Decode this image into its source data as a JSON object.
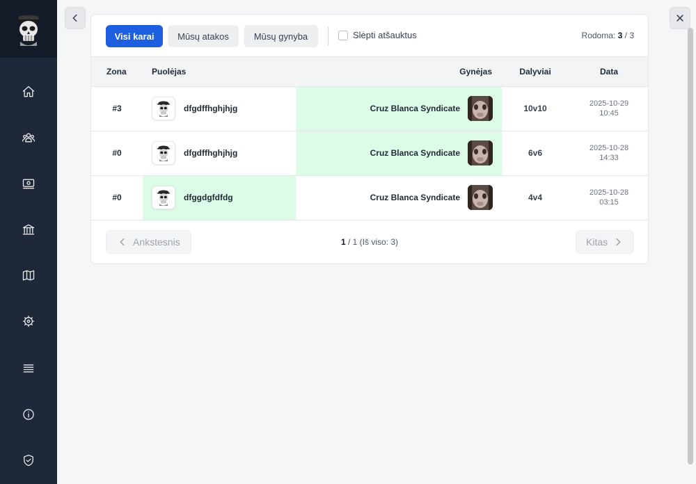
{
  "sidebar": {
    "items": [
      {
        "icon": "home-icon"
      },
      {
        "icon": "users-icon"
      },
      {
        "icon": "money-icon"
      },
      {
        "icon": "bank-icon"
      },
      {
        "icon": "map-icon"
      },
      {
        "icon": "gear-icon"
      },
      {
        "icon": "menu-icon"
      },
      {
        "icon": "info-icon"
      },
      {
        "icon": "shield-icon"
      }
    ]
  },
  "filters": {
    "tabs": [
      {
        "label": "Visi karai",
        "active": true
      },
      {
        "label": "Mūsų atakos",
        "active": false
      },
      {
        "label": "Mūsų gynyba",
        "active": false
      }
    ],
    "hide_cancelled_label": "Slėpti atšauktus",
    "showing_label": "Rodoma:",
    "showing_count": "3",
    "showing_sep": "/",
    "showing_total": "3"
  },
  "table": {
    "headers": {
      "zone": "Zona",
      "attacker": "Puolėjas",
      "defender": "Gynėjas",
      "participants": "Dalyviai",
      "date": "Data"
    },
    "rows": [
      {
        "zone": "#3",
        "attacker": "dfgdffhghjhjg",
        "defender": "Cruz Blanca Syndicate",
        "participants": "10v10",
        "date": "2025-10-29",
        "time": "10:45",
        "winner": "defender"
      },
      {
        "zone": "#0",
        "attacker": "dfgdffhghjhjg",
        "defender": "Cruz Blanca Syndicate",
        "participants": "6v6",
        "date": "2025-10-28",
        "time": "14:33",
        "winner": "defender"
      },
      {
        "zone": "#0",
        "attacker": "dfggdgfdfdg",
        "defender": "Cruz Blanca Syndicate",
        "participants": "4v4",
        "date": "2025-10-28",
        "time": "03:15",
        "winner": "attacker"
      }
    ]
  },
  "pagination": {
    "prev_label": "Ankstesnis",
    "next_label": "Kitas",
    "page_current": "1",
    "page_rest": " / 1 (Iš viso: 3)"
  },
  "colors": {
    "accent": "#1d5fe0",
    "sidebar": "#1e2838",
    "win_highlight": "#dcfce7"
  }
}
